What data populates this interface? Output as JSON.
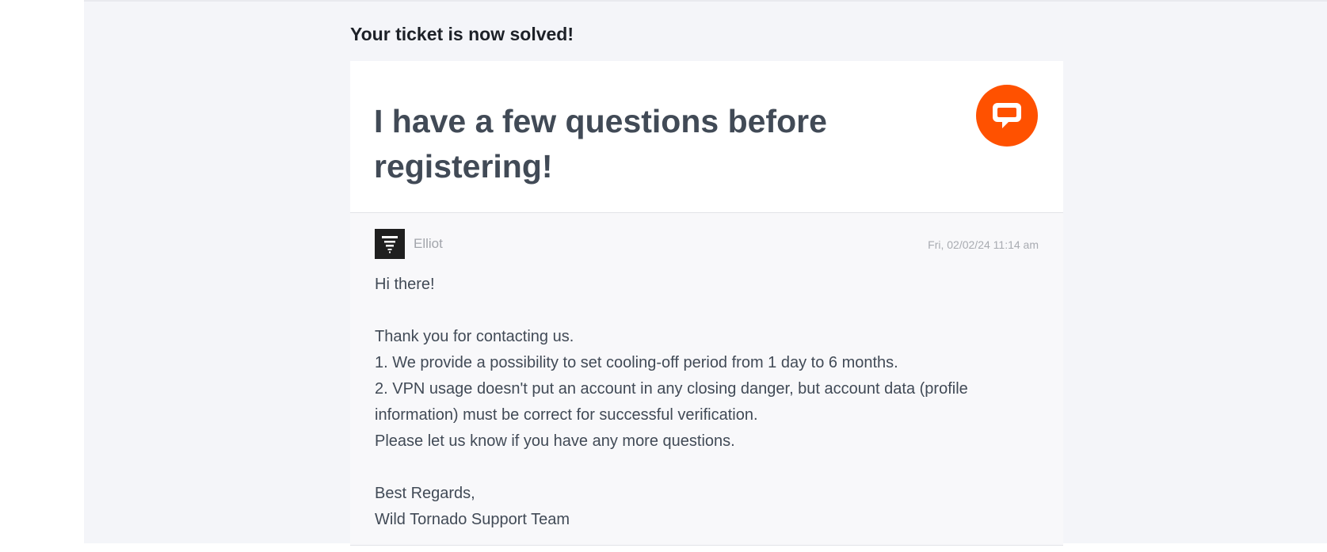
{
  "page": {
    "status_heading": "Your ticket is now solved!"
  },
  "ticket": {
    "title": "I have a few questions before registering!",
    "brand_icon": "chat-bubble-icon",
    "brand_color": "#ff5100"
  },
  "message": {
    "author": "Elliot",
    "avatar_icon": "tornado-logo-icon",
    "timestamp": "Fri, 02/02/24 11:14 am",
    "greeting": "Hi there!",
    "line1": "Thank you for contacting us.",
    "line2": "1. We provide a possibility to set cooling-off period from 1 day to 6 months.",
    "line3": "2. VPN usage doesn't put an account in any closing danger, but account data (profile information) must be correct for successful verification.",
    "line4": "Please let us know if you have any more questions.",
    "signoff": "Best Regards,",
    "team": "Wild Tornado Support Team"
  }
}
